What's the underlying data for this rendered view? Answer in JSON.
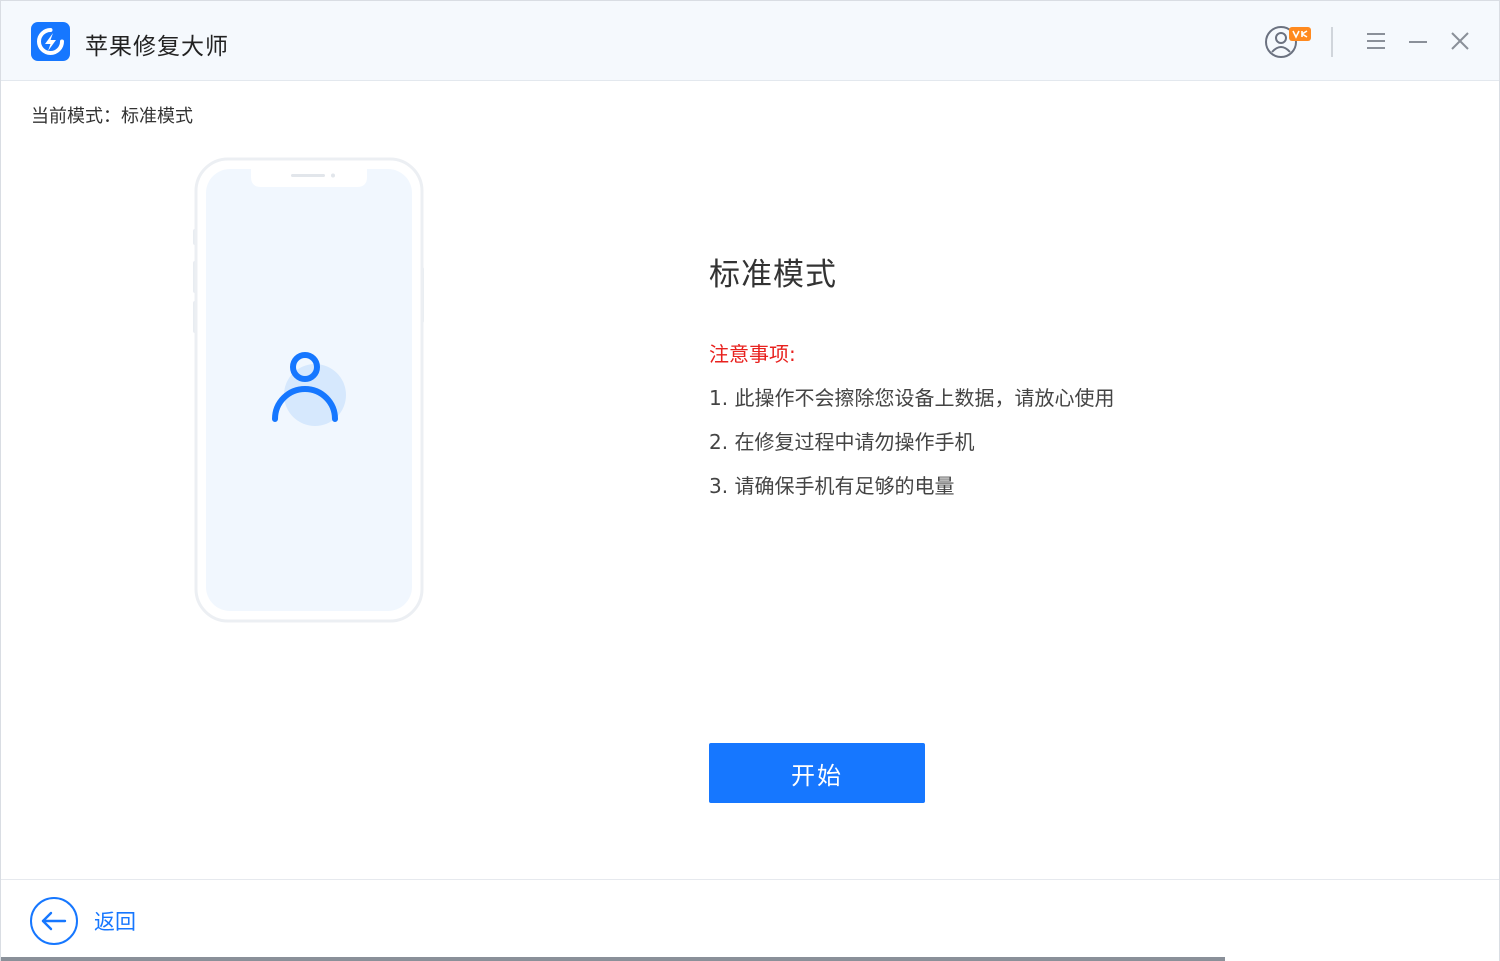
{
  "titlebar": {
    "app_title": "苹果修复大师",
    "icons": [
      "app-logo-icon",
      "user-account-icon",
      "menu-icon",
      "minimize-icon",
      "close-icon"
    ],
    "accent_color": "#1677ff",
    "badge_color": "#ff8a1f"
  },
  "mode": {
    "current_label": "当前模式：标准模式"
  },
  "main": {
    "title": "标准模式",
    "notice_title": "注意事项:",
    "notice_color": "#e8211e",
    "notices": [
      "1. 此操作不会擦除您设备上数据，请放心使用",
      "2. 在修复过程中请勿操作手机",
      "3. 请确保手机有足够的电量"
    ],
    "start_label": "开始"
  },
  "footer": {
    "back_label": "返回"
  }
}
